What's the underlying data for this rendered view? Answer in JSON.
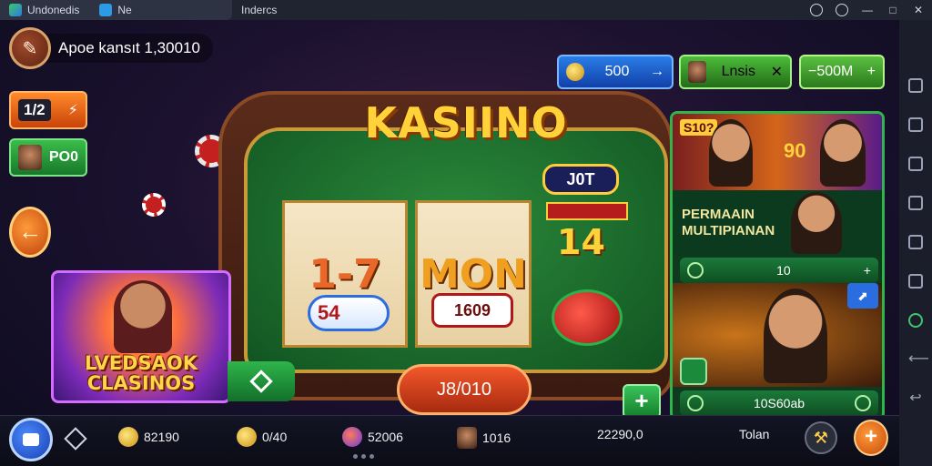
{
  "window": {
    "tab_title": "Undonedis",
    "home_tab": "Ne",
    "app_title": "Indercs"
  },
  "profile": {
    "text": "Apoe kansıt 1,30010"
  },
  "left": {
    "level": "1/2",
    "green_pill": "PO0"
  },
  "currency": {
    "blue": "500",
    "green_label": "Lnsis",
    "green2": "−500M"
  },
  "game": {
    "title": "KASIINO",
    "jackpot": "J0T",
    "reel1": "1-7",
    "reel2": "MON",
    "reel3": "14",
    "badge_left": "54",
    "badge_mid": "1609",
    "bet_button": "J8/010"
  },
  "promo": {
    "title_line1": "LVEDSAOK",
    "title_line2": "CLASINOS"
  },
  "panel": {
    "banner_label": "S10?",
    "banner_number": "90",
    "multiplayer_line1": "PERMAAIN",
    "multiplayer_line2": "MULTIPIANAN",
    "row1_value": "10",
    "row2_value": "10S60ab"
  },
  "bottom": {
    "coins": "82190",
    "gold": "0/40",
    "gems": "52006",
    "friends": "1016",
    "score": "22290,0",
    "label": "Tolan"
  },
  "colors": {
    "accent_green": "#2fb54a",
    "accent_orange": "#f2582a",
    "title_gold": "#ffd23a"
  }
}
